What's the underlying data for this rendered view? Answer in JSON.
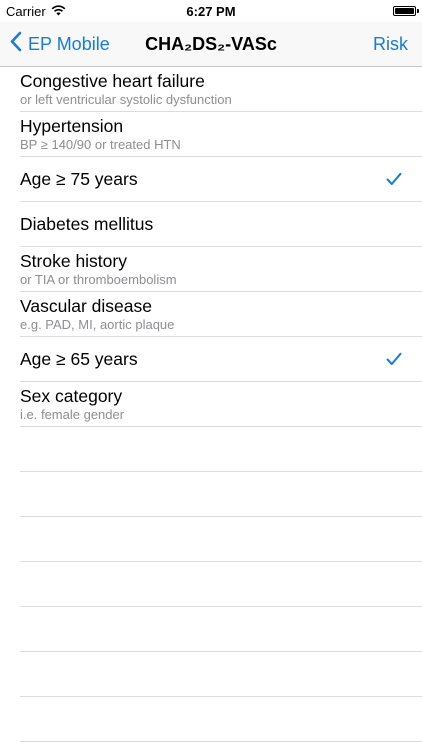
{
  "status_bar": {
    "carrier": "Carrier",
    "time": "6:27 PM"
  },
  "nav": {
    "back_label": "EP Mobile",
    "title": "CHA₂DS₂-VASc",
    "right_label": "Risk"
  },
  "rows": [
    {
      "title": "Congestive heart failure",
      "subtitle": "or left ventricular systolic dysfunction",
      "checked": false
    },
    {
      "title": "Hypertension",
      "subtitle": "BP ≥ 140/90 or treated HTN",
      "checked": false
    },
    {
      "title": "Age ≥ 75 years",
      "subtitle": "",
      "checked": true
    },
    {
      "title": "Diabetes mellitus",
      "subtitle": "",
      "checked": false
    },
    {
      "title": "Stroke history",
      "subtitle": "or TIA or thromboembolism",
      "checked": false
    },
    {
      "title": "Vascular disease",
      "subtitle": "e.g. PAD, MI, aortic plaque",
      "checked": false
    },
    {
      "title": "Age ≥ 65 years",
      "subtitle": "",
      "checked": true
    },
    {
      "title": "Sex category",
      "subtitle": "i.e. female gender",
      "checked": false
    }
  ],
  "colors": {
    "accent": "#1a7adb",
    "separator": "#dcdcdc",
    "subtitle": "#8e8e93"
  },
  "icons": {
    "back": "chevron-left-icon",
    "wifi": "wifi-icon",
    "battery": "battery-icon",
    "check": "checkmark-icon"
  }
}
